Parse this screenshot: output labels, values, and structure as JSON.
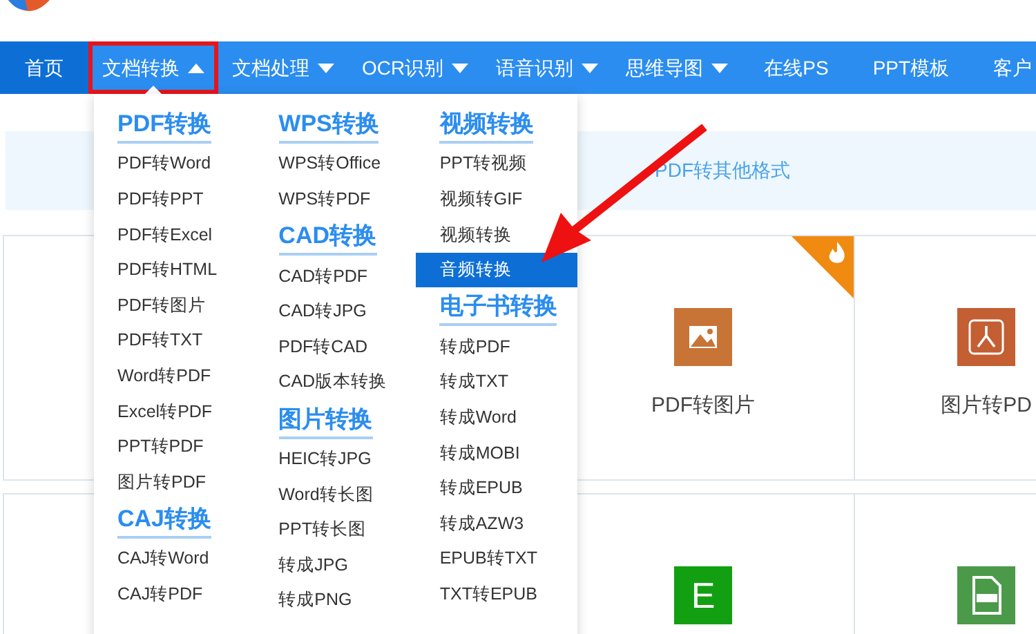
{
  "nav": [
    {
      "label": "首页",
      "selected": false,
      "kind": "home"
    },
    {
      "label": "文档转换",
      "selected": true,
      "kind": "menu",
      "expanded": true
    },
    {
      "label": "文档处理",
      "selected": false,
      "kind": "menu",
      "expanded": false
    },
    {
      "label": "OCR识别",
      "selected": false,
      "kind": "menu",
      "expanded": false
    },
    {
      "label": "语音识别",
      "selected": false,
      "kind": "menu",
      "expanded": false
    },
    {
      "label": "思维导图",
      "selected": false,
      "kind": "menu",
      "expanded": false
    },
    {
      "label": "在线PS",
      "selected": false,
      "kind": "link"
    },
    {
      "label": "PPT模板",
      "selected": false,
      "kind": "link"
    },
    {
      "label": "客户",
      "selected": false,
      "kind": "link"
    }
  ],
  "dropdown": {
    "columns": [
      [
        {
          "heading": "PDF转换",
          "items": [
            {
              "label": "PDF转Word",
              "selected": false
            },
            {
              "label": "PDF转PPT",
              "selected": false
            },
            {
              "label": "PDF转Excel",
              "selected": false
            },
            {
              "label": "PDF转HTML",
              "selected": false
            },
            {
              "label": "PDF转图片",
              "selected": false
            },
            {
              "label": "PDF转TXT",
              "selected": false
            },
            {
              "label": "Word转PDF",
              "selected": false
            },
            {
              "label": "Excel转PDF",
              "selected": false
            },
            {
              "label": "PPT转PDF",
              "selected": false
            },
            {
              "label": "图片转PDF",
              "selected": false
            }
          ]
        },
        {
          "heading": "CAJ转换",
          "items": [
            {
              "label": "CAJ转Word",
              "selected": false
            },
            {
              "label": "CAJ转PDF",
              "selected": false
            }
          ]
        }
      ],
      [
        {
          "heading": "WPS转换",
          "items": [
            {
              "label": "WPS转Office",
              "selected": false
            },
            {
              "label": "WPS转PDF",
              "selected": false
            }
          ]
        },
        {
          "heading": "CAD转换",
          "items": [
            {
              "label": "CAD转PDF",
              "selected": false
            },
            {
              "label": "CAD转JPG",
              "selected": false
            },
            {
              "label": "PDF转CAD",
              "selected": false
            },
            {
              "label": "CAD版本转换",
              "selected": false
            }
          ]
        },
        {
          "heading": "图片转换",
          "items": [
            {
              "label": "HEIC转JPG",
              "selected": false
            },
            {
              "label": "Word转长图",
              "selected": false
            },
            {
              "label": "PPT转长图",
              "selected": false
            },
            {
              "label": "转成JPG",
              "selected": false
            },
            {
              "label": "转成PNG",
              "selected": false
            }
          ]
        }
      ],
      [
        {
          "heading": "视频转换",
          "items": [
            {
              "label": "PPT转视频",
              "selected": false
            },
            {
              "label": "视频转GIF",
              "selected": false
            },
            {
              "label": "视频转换",
              "selected": false
            },
            {
              "label": "音频转换",
              "selected": true
            }
          ]
        },
        {
          "heading": "电子书转换",
          "items": [
            {
              "label": "转成PDF",
              "selected": false
            },
            {
              "label": "转成TXT",
              "selected": false
            },
            {
              "label": "转成Word",
              "selected": false
            },
            {
              "label": "转成MOBI",
              "selected": false
            },
            {
              "label": "转成EPUB",
              "selected": false
            },
            {
              "label": "转成AZW3",
              "selected": false
            },
            {
              "label": "EPUB转TXT",
              "selected": false
            },
            {
              "label": "TXT转EPUB",
              "selected": false
            }
          ]
        }
      ]
    ]
  },
  "banner": {
    "text": "PDF转其他格式"
  },
  "cards": [
    [
      {
        "kind": "blank",
        "hot": false
      },
      {
        "label": "PDF转图片",
        "kind": "image",
        "hot": true
      },
      {
        "label": "图片转PD",
        "kind": "pdf",
        "hot": false
      }
    ],
    [
      {
        "kind": "blank",
        "hot": false
      },
      {
        "kind": "letter",
        "letter": "E",
        "color": "#12a012",
        "hot": false
      },
      {
        "kind": "pdffile",
        "color": "#4a9a4a",
        "hot": false
      }
    ]
  ]
}
